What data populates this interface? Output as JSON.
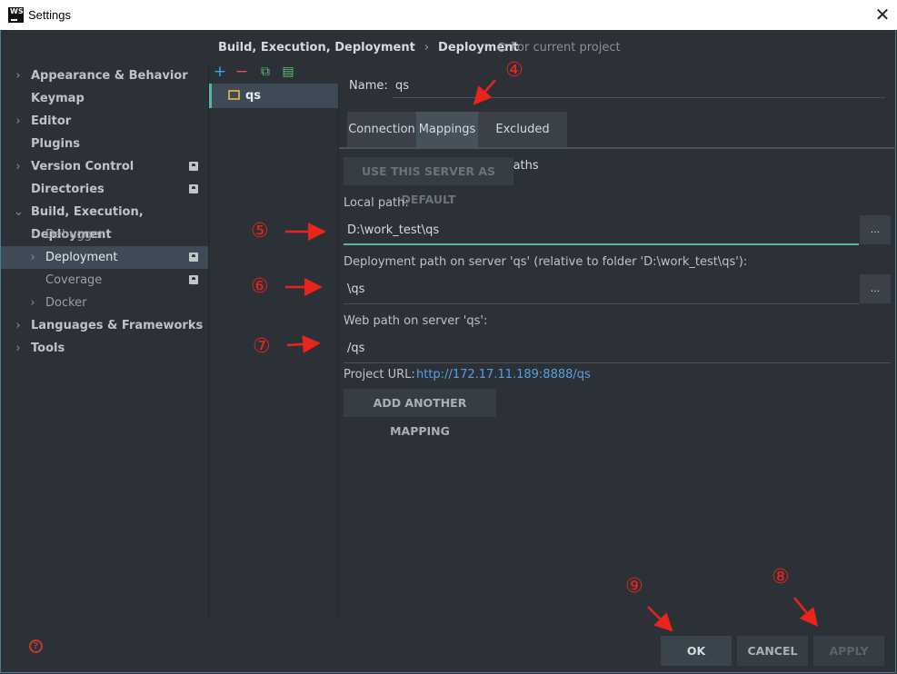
{
  "window": {
    "title": "Settings",
    "logo_text": "WS"
  },
  "sidebar": {
    "items": [
      {
        "label": "Appearance & Behavior",
        "level": 0,
        "arrow": "›",
        "badge": false,
        "selected": false
      },
      {
        "label": "Keymap",
        "level": 0,
        "arrow": "",
        "badge": false,
        "selected": false
      },
      {
        "label": "Editor",
        "level": 0,
        "arrow": "›",
        "badge": false,
        "selected": false
      },
      {
        "label": "Plugins",
        "level": 0,
        "arrow": "",
        "badge": false,
        "selected": false
      },
      {
        "label": "Version Control",
        "level": 0,
        "arrow": "›",
        "badge": true,
        "selected": false
      },
      {
        "label": "Directories",
        "level": 0,
        "arrow": "",
        "badge": true,
        "selected": false
      },
      {
        "label": "Build, Execution, Deployment",
        "level": 0,
        "arrow": "⌄",
        "badge": false,
        "selected": false
      },
      {
        "label": "Debugger",
        "level": 1,
        "arrow": "›",
        "badge": false,
        "selected": false
      },
      {
        "label": "Deployment",
        "level": 1,
        "arrow": "›",
        "badge": true,
        "selected": true
      },
      {
        "label": "Coverage",
        "level": 1,
        "arrow": "",
        "badge": true,
        "selected": false
      },
      {
        "label": "Docker",
        "level": 1,
        "arrow": "›",
        "badge": false,
        "selected": false
      },
      {
        "label": "Languages & Frameworks",
        "level": 0,
        "arrow": "›",
        "badge": false,
        "selected": false
      },
      {
        "label": "Tools",
        "level": 0,
        "arrow": "›",
        "badge": false,
        "selected": false
      }
    ]
  },
  "breadcrumb": {
    "parent": "Build, Execution, Deployment",
    "separator": "›",
    "current": "Deployment",
    "scope": "For current project"
  },
  "toolbar": {
    "add": "+",
    "remove": "−",
    "copy": "⧉",
    "default": "▤"
  },
  "servers": [
    {
      "name": "qs"
    }
  ],
  "config": {
    "name_label": "Name:",
    "name_value": "qs",
    "tabs": [
      "Connection",
      "Mappings",
      "Excluded Paths"
    ],
    "use_default_button": "USE THIS SERVER AS DEFAULT",
    "local_path_label": "Local path:",
    "local_path_value": "D:\\work_test\\qs",
    "deploy_path_label": "Deployment path on server 'qs' (relative to folder 'D:\\work_test\\qs'):",
    "deploy_path_value": "\\qs",
    "web_path_label": "Web path on server 'qs':",
    "web_path_value": "/qs",
    "project_url_label": "Project URL:",
    "project_url": "http://172.17.11.189:8888/qs",
    "add_mapping_button": "ADD ANOTHER MAPPING",
    "browse": "..."
  },
  "footer": {
    "ok": "OK",
    "cancel": "CANCEL",
    "apply": "APPLY",
    "help": "?"
  },
  "annotations": {
    "a4": "④",
    "a5": "⑤",
    "a6": "⑥",
    "a7": "⑦",
    "a8": "⑧",
    "a9": "⑨"
  },
  "colors": {
    "accent": "#56b5a6",
    "annotation": "#e8251a",
    "link": "#5a9fe0",
    "background": "#2b3137"
  }
}
